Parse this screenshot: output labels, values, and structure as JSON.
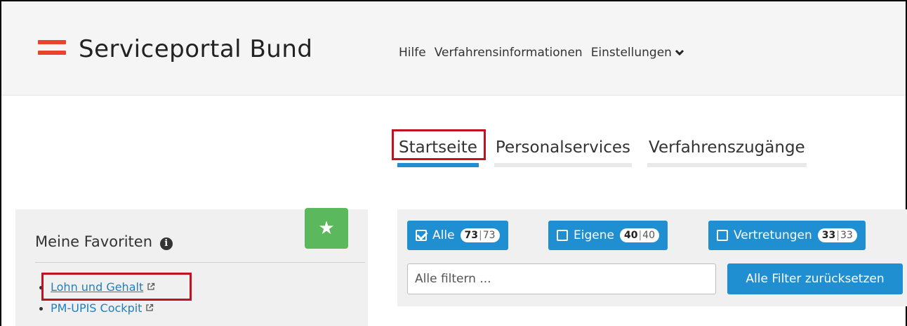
{
  "header": {
    "brand": "Serviceportal Bund",
    "nav": {
      "help": "Hilfe",
      "procedure_info": "Verfahrensinformationen",
      "settings": "Einstellungen"
    }
  },
  "tabs": [
    {
      "label": "Startseite",
      "active": true
    },
    {
      "label": "Personalservices",
      "active": false
    },
    {
      "label": "Verfahrenszugänge",
      "active": false
    }
  ],
  "favorites": {
    "title": "Meine Favoriten",
    "items": [
      {
        "label": "Lohn und Gehalt"
      },
      {
        "label": "PM-UPIS Cockpit"
      }
    ]
  },
  "filters": {
    "buttons": [
      {
        "label": "Alle",
        "checked": true,
        "count": "73",
        "total": "73"
      },
      {
        "label": "Eigene",
        "checked": false,
        "count": "40",
        "total": "40"
      },
      {
        "label": "Vertretungen",
        "checked": false,
        "count": "33",
        "total": "33"
      }
    ],
    "search_placeholder": "Alle filtern ...",
    "reset_label": "Alle Filter zurücksetzen"
  },
  "colors": {
    "accent_blue": "#1f8fd1",
    "brand_red": "#e8432b",
    "favorite_green": "#5cb85c",
    "highlight_red": "#c1121f"
  }
}
